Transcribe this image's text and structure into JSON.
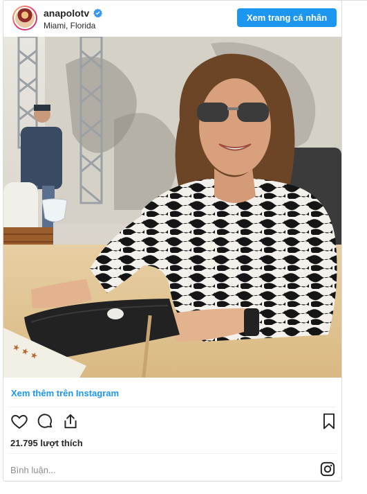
{
  "header": {
    "username": "anapolotv",
    "location": "Miami, Florida",
    "profile_button_label": "Xem trang cá nhân",
    "verified_icon": "verified-badge-icon",
    "avatar_icon": "profile-avatar"
  },
  "post": {
    "image_icon": "post-photo",
    "more_link_label": "Xem thêm trên Instagram",
    "likes_text": "21.795 lượt thích",
    "comment_placeholder": "Bình luận...",
    "action_icons": [
      "heart-icon",
      "comment-icon",
      "share-icon",
      "bookmark-icon"
    ],
    "brand_icon": "instagram-icon"
  },
  "colors": {
    "link_blue": "#1c96ee",
    "text": "#262626",
    "muted": "#8e8e8e",
    "border": "#dbdbdb"
  }
}
